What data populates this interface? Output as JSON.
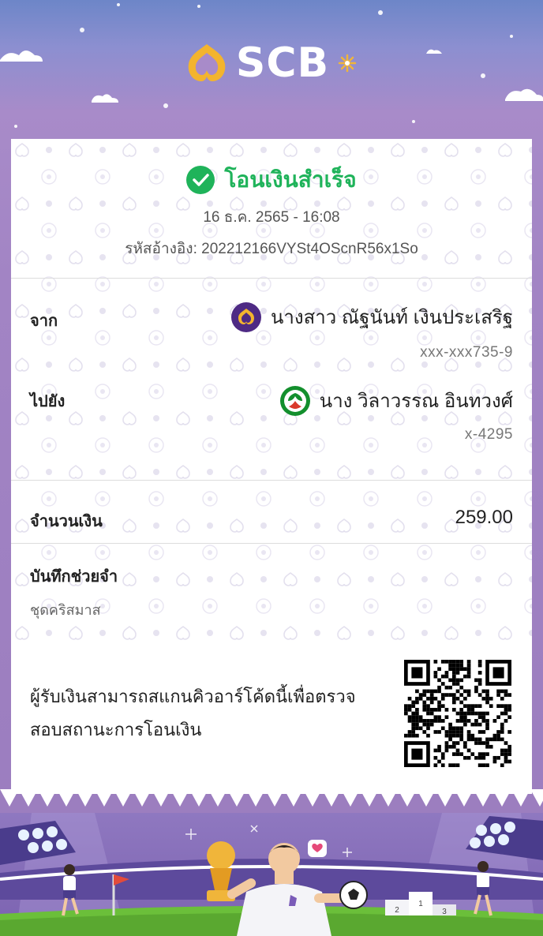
{
  "brand": {
    "name": "SCB"
  },
  "status": {
    "text": "โอนเงินสำเร็จ"
  },
  "date": "16 ธ.ค. 2565 - 16:08",
  "reference": "รหัสอ้างอิง: 202212166VYSt4OScnR56x1So",
  "from": {
    "label": "จาก",
    "name": "นางสาว ณัฐนันท์ เงินประเสริฐ",
    "account": "xxx-xxx735-9"
  },
  "to": {
    "label": "ไปยัง",
    "name": "นาง วิลาวรรณ อินทวงศ์",
    "account": "x-4295"
  },
  "amount": {
    "label": "จำนวนเงิน",
    "value": "259.00"
  },
  "memo": {
    "label": "บันทึกช่วยจำ",
    "value": "ชุดคริสมาส"
  },
  "note": "ผู้รับเงินสามารถสแกนคิวอาร์โค้ดนี้เพื่อตรวจสอบสถานะการโอนเงิน",
  "footer": {
    "podium_numbers": [
      "2",
      "1",
      "3"
    ]
  },
  "colors": {
    "success": "#1fb35a",
    "scb_purple": "#4e2a84",
    "kbank_green": "#138f2d",
    "gold": "#f0b53a"
  }
}
